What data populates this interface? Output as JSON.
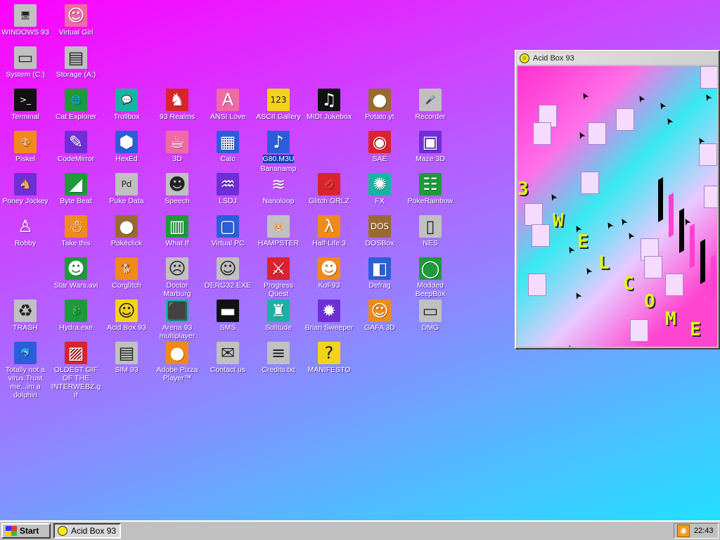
{
  "desktop": {
    "icons": [
      {
        "label": "WINDOWS 93",
        "glyph": "🖥",
        "cls": "g-gray",
        "name": "windows-93-icon",
        "col": 0,
        "row": 0
      },
      {
        "label": "Virtual Girl",
        "glyph": "☺",
        "cls": "g-pink",
        "name": "virtual-girl-icon",
        "col": 1,
        "row": 0
      },
      {
        "label": "System (C:)",
        "glyph": "▭",
        "cls": "g-gray",
        "name": "hard-drive-icon",
        "col": 0,
        "row": 1
      },
      {
        "label": "Storage (A:)",
        "glyph": "▤",
        "cls": "g-gray",
        "name": "floppy-drive-icon",
        "col": 1,
        "row": 1
      },
      {
        "label": "Terminal",
        "glyph": ">_",
        "cls": "g-dark",
        "name": "terminal-icon",
        "col": 0,
        "row": 2
      },
      {
        "label": "Cat Explorer",
        "glyph": "🌐",
        "cls": "g-green",
        "name": "globe-cat-icon",
        "col": 1,
        "row": 2
      },
      {
        "label": "Trollbox",
        "glyph": "💬",
        "cls": "g-teal",
        "name": "chat-bubble-icon",
        "col": 2,
        "row": 2
      },
      {
        "label": "93 Realms",
        "glyph": "♞",
        "cls": "g-red",
        "name": "knight-icon",
        "col": 3,
        "row": 2
      },
      {
        "label": "ANSI Love",
        "glyph": "A",
        "cls": "g-pink",
        "name": "letter-a-icon",
        "col": 4,
        "row": 2
      },
      {
        "label": "ASCII Gallery",
        "glyph": "123",
        "cls": "g-yellow",
        "name": "ascii-numbers-icon",
        "col": 5,
        "row": 2
      },
      {
        "label": "MIDI Jukebox",
        "glyph": "♫",
        "cls": "g-dark",
        "name": "piano-keys-icon",
        "col": 6,
        "row": 2
      },
      {
        "label": "Potato.yt",
        "glyph": "●",
        "cls": "g-brown",
        "name": "potato-icon",
        "col": 7,
        "row": 2
      },
      {
        "label": "Recorder",
        "glyph": "🎤",
        "cls": "g-gray",
        "name": "microphone-icon",
        "col": 8,
        "row": 2
      },
      {
        "label": "Piskel",
        "glyph": "🎨",
        "cls": "g-orange",
        "name": "paint-palette-icon",
        "col": 0,
        "row": 3
      },
      {
        "label": "CodeMirror",
        "glyph": "✎",
        "cls": "g-purple",
        "name": "code-mirror-icon",
        "col": 1,
        "row": 3
      },
      {
        "label": "HexEd",
        "glyph": "⬢",
        "cls": "g-blue",
        "name": "hex-cube-icon",
        "col": 2,
        "row": 3
      },
      {
        "label": "3D",
        "glyph": "☕",
        "cls": "g-pink",
        "name": "teapot-icon",
        "col": 3,
        "row": 3
      },
      {
        "label": "Calc",
        "glyph": "▦",
        "cls": "g-blue",
        "name": "calculator-icon",
        "col": 4,
        "row": 3
      },
      {
        "label": "Bananamp",
        "glyph": "♪",
        "cls": "g-blue",
        "name": "music-file-icon",
        "col": 5,
        "row": 3,
        "selected": true,
        "sel_label": "G80.M3U"
      },
      {
        "label": "SAE",
        "glyph": "◉",
        "cls": "g-red",
        "name": "amiga-ball-icon",
        "col": 7,
        "row": 3
      },
      {
        "label": "Maze 3D",
        "glyph": "▣",
        "cls": "g-purple",
        "name": "maze-icon",
        "col": 8,
        "row": 3
      },
      {
        "label": "Poney Jockey",
        "glyph": "🐴",
        "cls": "g-purple",
        "name": "pony-icon",
        "col": 0,
        "row": 4
      },
      {
        "label": "Byte Beat",
        "glyph": "◢",
        "cls": "g-green",
        "name": "byte-beat-icon",
        "col": 1,
        "row": 4
      },
      {
        "label": "Puke Data",
        "glyph": "Pd",
        "cls": "g-gray",
        "name": "pure-data-icon",
        "col": 2,
        "row": 4
      },
      {
        "label": "Speech",
        "glyph": "☻",
        "cls": "g-gray",
        "name": "speech-face-icon",
        "col": 3,
        "row": 4
      },
      {
        "label": "LSDJ",
        "glyph": "♒",
        "cls": "g-purple",
        "name": "lsdj-icon",
        "col": 4,
        "row": 4
      },
      {
        "label": "Nanoloop",
        "glyph": "≋",
        "cls": "g-none",
        "name": "nanoloop-icon",
        "col": 5,
        "row": 4
      },
      {
        "label": "Glitch GRLZ",
        "glyph": "💋",
        "cls": "g-red",
        "name": "lips-icon",
        "col": 6,
        "row": 4
      },
      {
        "label": "FX",
        "glyph": "✺",
        "cls": "g-teal",
        "name": "atom-icon",
        "col": 7,
        "row": 4
      },
      {
        "label": "PokeRainbow",
        "glyph": "☷",
        "cls": "g-green",
        "name": "poke-rainbow-icon",
        "col": 8,
        "row": 4
      },
      {
        "label": "Robby",
        "glyph": "♙",
        "cls": "g-none",
        "name": "stick-figure-icon",
        "col": 0,
        "row": 5
      },
      {
        "label": "Take this",
        "glyph": "☃",
        "cls": "g-orange",
        "name": "old-man-icon",
        "col": 1,
        "row": 5
      },
      {
        "label": "Pokéclick",
        "glyph": "●",
        "cls": "g-brown",
        "name": "cookie-icon",
        "col": 2,
        "row": 5
      },
      {
        "label": "What If",
        "glyph": "▥",
        "cls": "g-green",
        "name": "what-if-icon",
        "col": 3,
        "row": 5
      },
      {
        "label": "Virtual PC",
        "glyph": "▢",
        "cls": "g-blue",
        "name": "virtual-pc-icon",
        "col": 4,
        "row": 5
      },
      {
        "label": "HAMPSTER",
        "glyph": "🐹",
        "cls": "g-gray",
        "name": "hamster-icon",
        "col": 5,
        "row": 5
      },
      {
        "label": "Half-Life 3",
        "glyph": "λ",
        "cls": "g-orange",
        "name": "lambda-icon",
        "col": 6,
        "row": 5
      },
      {
        "label": "DOSBox",
        "glyph": "DOS",
        "cls": "g-brown",
        "name": "dosbox-icon",
        "col": 7,
        "row": 5
      },
      {
        "label": "NES",
        "glyph": "▯",
        "cls": "g-gray",
        "name": "nes-console-icon",
        "col": 8,
        "row": 5
      },
      {
        "label": "Star Wars.avi",
        "glyph": "☻",
        "cls": "g-green",
        "name": "yoda-icon",
        "col": 1,
        "row": 6
      },
      {
        "label": "Corglitch",
        "glyph": "🐕",
        "cls": "g-orange",
        "name": "corgi-icon",
        "col": 2,
        "row": 6
      },
      {
        "label": "Doctor Marburg",
        "glyph": "☹",
        "cls": "g-gray",
        "name": "doctor-icon",
        "col": 3,
        "row": 6
      },
      {
        "label": "DERG32.EXE",
        "glyph": "☺",
        "cls": "g-gray",
        "name": "monitor-face-icon",
        "col": 4,
        "row": 6
      },
      {
        "label": "Progress Quest",
        "glyph": "⚔",
        "cls": "g-red",
        "name": "swords-icon",
        "col": 5,
        "row": 6
      },
      {
        "label": "KoF93",
        "glyph": "☻",
        "cls": "g-orange",
        "name": "fighter-icon",
        "col": 6,
        "row": 6
      },
      {
        "label": "Defrag",
        "glyph": "◧",
        "cls": "g-blue",
        "name": "defrag-icon",
        "col": 7,
        "row": 6
      },
      {
        "label": "Modded BeepBox",
        "glyph": "◯",
        "cls": "g-green",
        "name": "beepbox-ring-icon",
        "col": 8,
        "row": 6
      },
      {
        "label": "TRASH",
        "glyph": "♻",
        "cls": "g-gray",
        "name": "trash-icon",
        "col": 0,
        "row": 7
      },
      {
        "label": "Hydra.exe",
        "glyph": "🐉",
        "cls": "g-green",
        "name": "hydra-icon",
        "col": 1,
        "row": 7
      },
      {
        "label": "Acid Box 93",
        "glyph": "☺",
        "cls": "g-yellow",
        "name": "smiley-icon",
        "col": 2,
        "row": 7
      },
      {
        "label": "Arena 93 multiplayer",
        "glyph": "⬛",
        "cls": "g-teal",
        "name": "cube-icon",
        "col": 3,
        "row": 7
      },
      {
        "label": "SMS",
        "glyph": "▬",
        "cls": "g-dark",
        "name": "sms-console-icon",
        "col": 4,
        "row": 7
      },
      {
        "label": "Solitude",
        "glyph": "♜",
        "cls": "g-teal",
        "name": "solitude-icon",
        "col": 5,
        "row": 7
      },
      {
        "label": "Brian Sweeper",
        "glyph": "✹",
        "cls": "g-purple",
        "name": "mine-icon",
        "col": 6,
        "row": 7
      },
      {
        "label": "GAFA 3D",
        "glyph": "☺",
        "cls": "g-orange",
        "name": "doom-face-icon",
        "col": 7,
        "row": 7
      },
      {
        "label": "DMG",
        "glyph": "▭",
        "cls": "g-gray",
        "name": "gameboy-icon",
        "col": 8,
        "row": 7
      },
      {
        "label": "Totally not a virus.Trust me...im a dolphin",
        "glyph": "🐬",
        "cls": "g-blue",
        "name": "dolphin-icon",
        "col": 0,
        "row": 8
      },
      {
        "label": "OLDEST GIF OF THE INTERWEBZ.gif",
        "glyph": "▨",
        "cls": "g-red",
        "name": "gif-file-icon",
        "col": 1,
        "row": 8
      },
      {
        "label": "SIM 93",
        "glyph": "▤",
        "cls": "g-gray",
        "name": "book-icon",
        "col": 2,
        "row": 8
      },
      {
        "label": "Adobe Pizza Player™",
        "glyph": "●",
        "cls": "g-orange",
        "name": "pizza-icon",
        "col": 3,
        "row": 8
      },
      {
        "label": "Contact us",
        "glyph": "✉",
        "cls": "g-gray",
        "name": "letter-icon",
        "col": 4,
        "row": 8
      },
      {
        "label": "Credits.txt",
        "glyph": "≡",
        "cls": "g-gray",
        "name": "text-file-icon",
        "col": 5,
        "row": 8
      },
      {
        "label": "MANIFESTO",
        "glyph": "?",
        "cls": "g-yellow",
        "name": "question-mark-icon",
        "col": 6,
        "row": 8
      }
    ]
  },
  "window": {
    "title": "Acid Box 93",
    "welcome_letters": [
      "3",
      "W",
      "E",
      "L",
      "C",
      "O",
      "M",
      "E"
    ]
  },
  "taskbar": {
    "start_label": "Start",
    "task_label": "Acid Box 93",
    "clock": "22:43"
  }
}
